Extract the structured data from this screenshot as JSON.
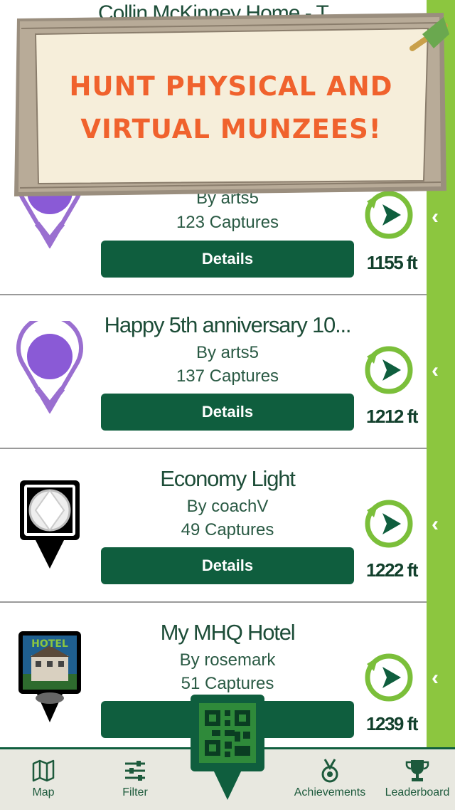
{
  "banner": {
    "line1": "HUNT PHYSICAL AND",
    "line2": "VIRTUAL MUNZEES!"
  },
  "partial_title": "Collin McKinney Home - T",
  "items": [
    {
      "title": "",
      "by": "By arts5",
      "captures": "123 Captures",
      "details_label": "Details",
      "distance": "1155 ft",
      "icon": "purple-gem-virtual-icon"
    },
    {
      "title": "Happy 5th anniversary 10...",
      "by": "By arts5",
      "captures": "137 Captures",
      "details_label": "Details",
      "distance": "1212 ft",
      "icon": "purple-gem-virtual-icon"
    },
    {
      "title": "Economy Light",
      "by": "By coachV",
      "captures": "49 Captures",
      "details_label": "Details",
      "distance": "1222 ft",
      "icon": "white-diamond-pin-icon"
    },
    {
      "title": "My MHQ Hotel",
      "by": "By rosemark",
      "captures": "51 Captures",
      "details_label": "Details",
      "distance": "1239 ft",
      "icon": "hotel-pin-icon"
    }
  ],
  "tabbar": {
    "map": "Map",
    "filter": "Filter",
    "achievements": "Achievements",
    "leaderboard": "Leaderboard"
  },
  "colors": {
    "accent_green": "#0f5e3e",
    "sidebar_green": "#8cc63f",
    "banner_orange": "#f0622d"
  }
}
